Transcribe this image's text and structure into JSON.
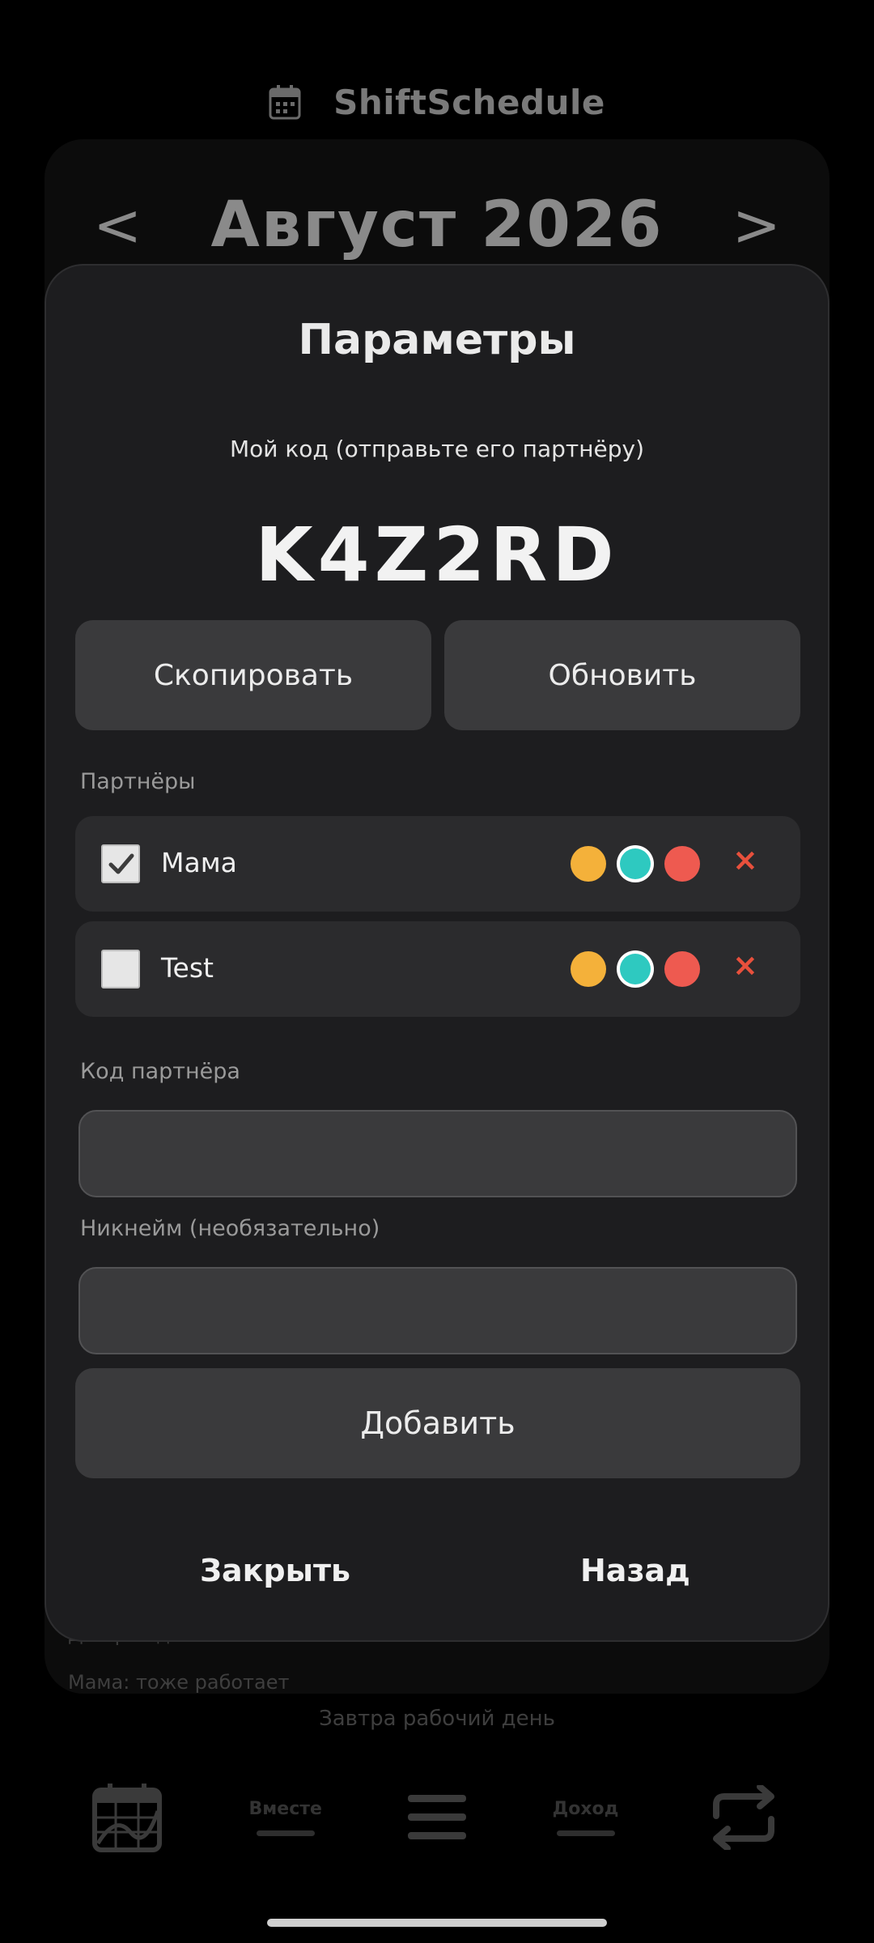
{
  "app": {
    "title": "ShiftSchedule",
    "month_title": "Август 2026",
    "prev_arrow": "<",
    "next_arrow": ">",
    "bg_partial_line1": "Дни рождения",
    "bg_partial_line2": "Мама: тоже работает",
    "tomorrow_text": "Завтра рабочий день"
  },
  "bottom_nav": {
    "together_label": "Вместе",
    "income_label": "Доход"
  },
  "modal": {
    "title": "Параметры",
    "code_label": "Мой код (отправьте его партнёру)",
    "my_code": "K4Z2RD",
    "copy_button": "Скопировать",
    "refresh_button": "Обновить",
    "partners_label": "Партнёры",
    "partners": [
      {
        "name": "Мама",
        "checked": true
      },
      {
        "name": "Test",
        "checked": false
      }
    ],
    "color_options": [
      "#f4b13a",
      "#2ec9c0",
      "#ee5a50"
    ],
    "remove_symbol": "×",
    "partner_code_label": "Код партнёра",
    "partner_code_value": "",
    "nickname_label": "Никнейм (необязательно)",
    "nickname_value": "",
    "add_button": "Добавить",
    "close_button": "Закрыть",
    "back_button": "Назад"
  },
  "colors": {
    "background": "#000000",
    "modal": "#1d1d1f",
    "button": "#3a3a3c",
    "row": "#2b2b2d",
    "remove": "#e8503c"
  }
}
